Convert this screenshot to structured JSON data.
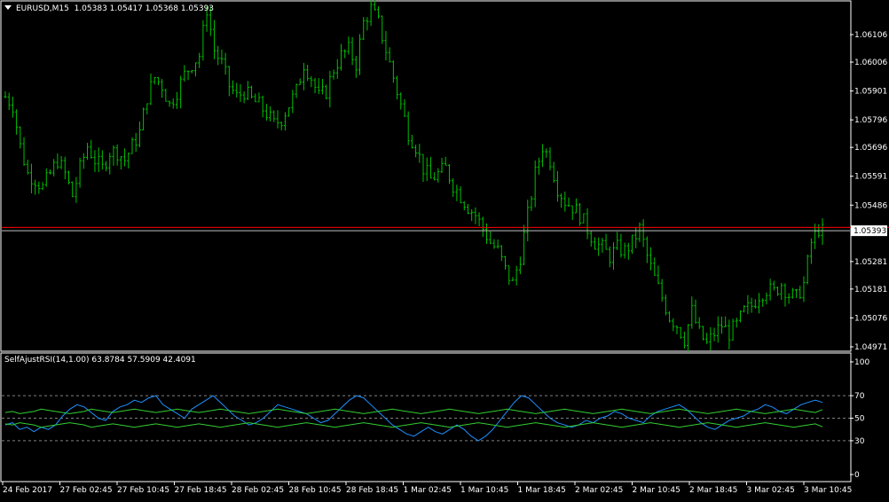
{
  "symbol_header": {
    "symbol_timeframe": "EURUSD,M15",
    "ohlc": "1.05383 1.05417 1.05368 1.05393"
  },
  "indicator_header": {
    "name": "SelfAjustRSI(14,1.00)",
    "values": "63.8784 57.5909 42.4091"
  },
  "colors": {
    "background": "#000000",
    "candles": "#00c000",
    "axis": "#ffffff",
    "bid_line": "#ff0000",
    "current_price_line": "#c0c0c0",
    "rsi_line": "#1e90ff",
    "band_lines": "#32cd32",
    "level_lines": "#808080"
  },
  "chart_data": [
    {
      "type": "candlestick",
      "symbol": "EURUSD",
      "timeframe": "M15",
      "ylim": [
        1.04971,
        1.06206
      ],
      "y_ticks": [
        "1.06106",
        "1.06006",
        "1.05901",
        "1.05796",
        "1.05696",
        "1.05591",
        "1.05486",
        "1.05281",
        "1.05181",
        "1.05076",
        "1.04971"
      ],
      "current_price_label": "1.05393",
      "current_price": 1.05393,
      "bid_line_price": 1.05405,
      "x_ticks": [
        "24 Feb 2017",
        "27 Feb 02:45",
        "27 Feb 10:45",
        "27 Feb 18:45",
        "28 Feb 02:45",
        "28 Feb 10:45",
        "28 Feb 18:45",
        "1 Mar 02:45",
        "1 Mar 10:45",
        "1 Mar 18:45",
        "2 Mar 02:45",
        "2 Mar 10:45",
        "2 Mar 18:45",
        "3 Mar 02:45",
        "3 Mar 10:45"
      ],
      "close_path": [
        [
          0,
          1.0588
        ],
        [
          2,
          1.0585
        ],
        [
          4,
          1.057
        ],
        [
          6,
          1.056
        ],
        [
          8,
          1.0558
        ],
        [
          10,
          1.0555
        ],
        [
          12,
          1.056
        ],
        [
          14,
          1.0565
        ],
        [
          16,
          1.056
        ],
        [
          18,
          1.0552
        ],
        [
          20,
          1.0562
        ],
        [
          22,
          1.057
        ],
        [
          24,
          1.0565
        ],
        [
          26,
          1.0562
        ],
        [
          28,
          1.0568
        ],
        [
          30,
          1.0568
        ],
        [
          32,
          1.0565
        ],
        [
          34,
          1.057
        ],
        [
          36,
          1.0575
        ],
        [
          38,
          1.0588
        ],
        [
          40,
          1.0595
        ],
        [
          42,
          1.0592
        ],
        [
          44,
          1.0585
        ],
        [
          46,
          1.059
        ],
        [
          48,
          1.0596
        ],
        [
          50,
          1.06
        ],
        [
          52,
          1.0603
        ],
        [
          54,
          1.062
        ],
        [
          56,
          1.0605
        ],
        [
          58,
          1.06
        ],
        [
          60,
          1.0592
        ],
        [
          62,
          1.0588
        ],
        [
          64,
          1.059
        ],
        [
          66,
          1.0587
        ],
        [
          68,
          1.0585
        ],
        [
          70,
          1.0582
        ],
        [
          72,
          1.0578
        ],
        [
          74,
          1.058
        ],
        [
          76,
          1.0585
        ],
        [
          78,
          1.059
        ],
        [
          80,
          1.06
        ],
        [
          82,
          1.0595
        ],
        [
          84,
          1.0588
        ],
        [
          86,
          1.059
        ],
        [
          88,
          1.0598
        ],
        [
          90,
          1.0603
        ],
        [
          92,
          1.0605
        ],
        [
          94,
          1.06
        ],
        [
          96,
          1.0615
        ],
        [
          98,
          1.062
        ],
        [
          100,
          1.0615
        ],
        [
          102,
          1.0605
        ],
        [
          104,
          1.0595
        ],
        [
          106,
          1.0585
        ],
        [
          108,
          1.0575
        ],
        [
          110,
          1.057
        ],
        [
          112,
          1.0562
        ],
        [
          114,
          1.0558
        ],
        [
          116,
          1.056
        ],
        [
          118,
          1.0562
        ],
        [
          120,
          1.0556
        ],
        [
          122,
          1.0552
        ],
        [
          124,
          1.0548
        ],
        [
          126,
          1.0545
        ],
        [
          128,
          1.054
        ],
        [
          130,
          1.0535
        ],
        [
          132,
          1.0532
        ],
        [
          134,
          1.0525
        ],
        [
          136,
          1.052
        ],
        [
          138,
          1.053
        ],
        [
          140,
          1.0545
        ],
        [
          142,
          1.056
        ],
        [
          144,
          1.057
        ],
        [
          146,
          1.0565
        ],
        [
          148,
          1.0555
        ],
        [
          150,
          1.055
        ],
        [
          152,
          1.0548
        ],
        [
          154,
          1.0545
        ],
        [
          156,
          1.054
        ],
        [
          158,
          1.0535
        ],
        [
          160,
          1.0533
        ],
        [
          162,
          1.053
        ],
        [
          164,
          1.0533
        ],
        [
          166,
          1.0532
        ],
        [
          168,
          1.0535
        ],
        [
          170,
          1.054
        ],
        [
          172,
          1.053
        ],
        [
          174,
          1.0522
        ],
        [
          176,
          1.0515
        ],
        [
          178,
          1.0508
        ],
        [
          180,
          1.0505
        ],
        [
          182,
          1.05
        ],
        [
          184,
          1.051
        ],
        [
          186,
          1.0502
        ],
        [
          188,
          1.0498
        ],
        [
          190,
          1.0502
        ],
        [
          192,
          1.0505
        ],
        [
          194,
          1.0502
        ],
        [
          196,
          1.0505
        ],
        [
          198,
          1.051
        ],
        [
          200,
          1.0512
        ],
        [
          202,
          1.0516
        ],
        [
          204,
          1.0518
        ],
        [
          206,
          1.0517
        ],
        [
          208,
          1.052
        ],
        [
          210,
          1.0516
        ],
        [
          212,
          1.0515
        ],
        [
          214,
          1.052
        ],
        [
          216,
          1.0535
        ],
        [
          218,
          1.054
        ],
        [
          219,
          1.0539
        ]
      ],
      "high_bars": 219
    },
    {
      "type": "line",
      "title": "SelfAjustRSI(14,1.00)",
      "ylim": [
        0,
        100
      ],
      "y_ticks": [
        "100",
        "70",
        "50",
        "30",
        "0"
      ],
      "levels": [
        70,
        50,
        30
      ],
      "series": [
        {
          "name": "",
          "values": [
            44,
            46,
            40,
            42,
            38,
            42,
            40,
            44,
            52,
            58,
            62,
            60,
            55,
            50,
            48,
            56,
            60,
            62,
            66,
            64,
            68,
            70,
            62,
            58,
            54,
            50,
            58,
            62,
            66,
            70,
            64,
            58,
            52,
            48,
            44,
            46,
            50,
            56,
            62,
            60,
            58,
            56,
            54,
            50,
            46,
            48,
            54,
            60,
            66,
            70,
            68,
            62,
            56,
            50,
            44,
            40,
            36,
            34,
            38,
            42,
            38,
            36,
            40,
            44,
            40,
            34,
            30,
            34,
            40,
            48,
            56,
            64,
            70,
            68,
            62,
            56,
            50,
            46,
            44,
            42,
            44,
            48,
            46,
            50,
            52,
            56,
            54,
            50,
            48,
            46,
            52,
            56,
            58,
            60,
            62,
            58,
            52,
            46,
            42,
            40,
            44,
            48,
            50,
            52,
            56,
            58,
            62,
            60,
            56,
            54,
            58,
            62,
            64,
            66,
            64
          ]
        },
        {
          "name": "",
          "values": [
            55,
            56,
            54,
            55,
            56,
            58,
            57,
            56,
            55,
            54,
            55,
            56,
            58,
            57,
            56,
            55,
            56,
            57,
            58,
            57,
            56,
            55,
            56,
            57,
            58,
            57,
            56,
            55,
            56,
            57,
            58,
            57,
            56,
            55,
            54,
            55,
            56,
            57,
            58,
            57,
            56,
            55,
            54,
            55,
            56,
            57,
            58,
            57,
            56,
            55,
            54,
            55,
            56,
            57,
            58,
            57,
            56,
            55,
            54,
            55,
            56,
            57,
            58,
            57,
            56,
            55,
            54,
            55,
            56,
            57,
            58,
            57,
            56,
            55,
            54,
            55,
            56,
            57,
            58,
            57,
            56,
            55,
            54,
            55,
            56,
            57,
            58,
            57,
            56,
            55,
            54,
            55,
            56,
            57,
            58,
            57,
            56,
            55,
            54,
            55,
            56,
            57,
            58,
            57,
            56,
            55,
            54,
            55,
            56,
            57,
            58,
            57,
            56,
            55,
            57.6
          ]
        },
        {
          "name": "",
          "values": [
            45,
            44,
            46,
            45,
            44,
            42,
            43,
            44,
            45,
            46,
            45,
            44,
            42,
            43,
            44,
            45,
            44,
            43,
            42,
            43,
            44,
            45,
            44,
            43,
            42,
            43,
            44,
            45,
            44,
            43,
            42,
            43,
            44,
            45,
            46,
            45,
            44,
            43,
            42,
            43,
            44,
            45,
            46,
            45,
            44,
            43,
            42,
            43,
            44,
            45,
            46,
            45,
            44,
            43,
            42,
            43,
            44,
            45,
            46,
            45,
            44,
            43,
            42,
            43,
            44,
            45,
            46,
            45,
            44,
            43,
            42,
            43,
            44,
            45,
            46,
            45,
            44,
            43,
            42,
            43,
            44,
            45,
            46,
            45,
            44,
            43,
            42,
            43,
            44,
            45,
            46,
            45,
            44,
            43,
            42,
            43,
            44,
            45,
            46,
            45,
            44,
            43,
            42,
            43,
            44,
            45,
            46,
            45,
            44,
            43,
            42,
            43,
            44,
            45,
            42.4
          ]
        }
      ]
    }
  ]
}
